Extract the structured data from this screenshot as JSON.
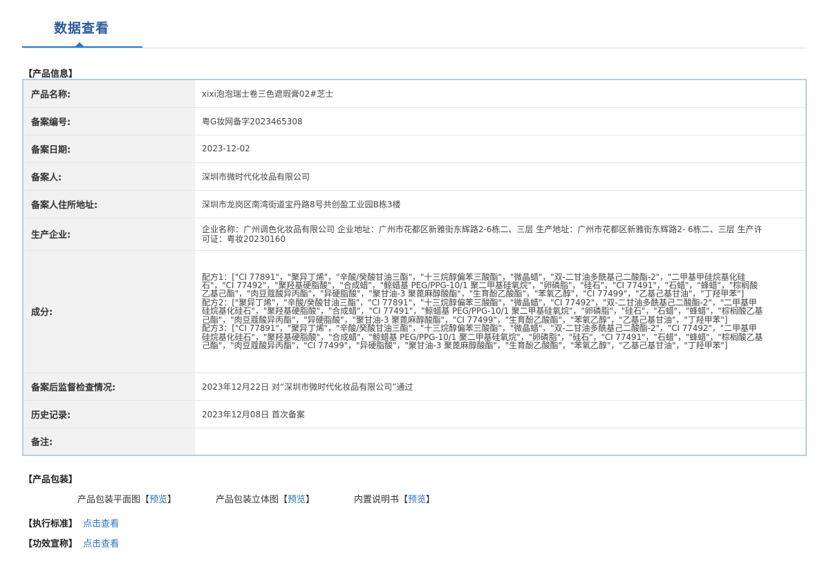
{
  "header": {
    "tab_title": "数据查看"
  },
  "product_info": {
    "section_title": "【产品信息】",
    "rows": [
      {
        "label": "产品名称:",
        "value": "xixi泡泡瑞士卷三色遮瑕膏02#芝士"
      },
      {
        "label": "备案编号:",
        "value": "粤G妆网备字2023465308"
      },
      {
        "label": "备案日期:",
        "value": "2023-12-02"
      },
      {
        "label": "备案人:",
        "value": "深圳市微时代化妆品有限公司"
      },
      {
        "label": "备案人住所地址:",
        "value": "深圳市龙岗区南湾街道宝丹路8号共创盈工业园B栋3楼"
      },
      {
        "label": "生产企业:",
        "value": "企业名称：广州调色化妆品有限公司 企业地址：广州市花都区新雅街东辉路2-6栋二、三层 生产地址：广州市花都区新雅街东辉路2- 6栋二、三层 生产许可证：粤妆20230160"
      },
      {
        "label": "成分:",
        "formulas": [
          "配方1：[\"CI 77891\"，\"聚异丁烯\"，\"辛酸/癸酸甘油三酯\"，\"十三烷醇偏苯三酸酯\"，\"微晶蜡\"，\"双-二甘油多酰基己二酸酯-2\"，\"二甲基甲硅烷基化硅石\"，\"CI 77492\"，\"聚羟基硬脂酸\"，\"合成蜡\"，\"鲸蜡基 PEG/PPG-10/1 聚二甲基硅氧烷\"，\"卵磷脂\"，\"硅石\"，\"CI 77491\"，\"石蜡\"，\"蜂蜡\"，\"棕榈酸乙基己酯\"，\"肉豆蔻酸异丙酯\"，\"异硬脂酸\"，\"聚甘油-3 聚蓖麻醇酸酯\"，\"生育酚乙酸酯\"，\"苯氧乙醇\"，\"CI 77499\"，\"乙基己基甘油\"，\"丁羟甲苯\"]",
          "配方2：[\"聚异丁烯\"，\"辛酸/癸酸甘油三酯\"，\"CI 77891\"，\"十三烷醇偏苯三酸酯\"，\"微晶蜡\"，\"CI 77492\"，\"双-二甘油多酰基己二酸酯-2\"，\"二甲基甲硅烷基化硅石\"，\"聚羟基硬脂酸\"，\"合成蜡\"，\"CI 77491\"，\"鲸蜡基 PEG/PPG-10/1 聚二甲基硅氧烷\"，\"卵磷脂\"，\"硅石\"，\"石蜡\"，\"蜂蜡\"，\"棕榈酸乙基己酯\"，\"肉豆蔻酸异丙酯\"，\"异硬脂酸\"，\"聚甘油-3 聚蓖麻醇酸酯\"，\"CI 77499\"，\"生育酚乙酸酯\"，\"苯氧乙醇\"，\"乙基己基甘油\"，\"丁羟甲苯\"]",
          "配方3：[\"CI 77891\"，\"聚异丁烯\"，\"辛酸/癸酸甘油三酯\"，\"十三烷醇偏苯三酸酯\"，\"微晶蜡\"，\"双-二甘油多酰基己二酸酯-2\"，\"CI 77492\"，\"二甲基甲硅烷基化硅石\"，\"聚羟基硬脂酸\"，\"合成蜡\"，\"鲸蜡基 PEG/PPG-10/1 聚二甲基硅氧烷\"，\"卵磷脂\"，\"硅石\"，\"CI 77491\"，\"石蜡\"，\"蜂蜡\"，\"棕榈酸乙基己酯\"，\"肉豆蔻酸异丙酯\"，\"CI 77499\"，\"异硬脂酸\"，\"聚甘油-3 聚蓖麻醇酸酯\"，\"生育酚乙酸酯\"，\"苯氧乙醇\"，\"乙基己基甘油\"，\"丁羟甲苯\"]"
        ]
      },
      {
        "label": "备案后监督检查情况:",
        "value": "2023年12月22日 对“深圳市微时代化妆品有限公司”通过"
      },
      {
        "label": "历史记录:",
        "value": "2023年12月08日 首次备案"
      },
      {
        "label": "备注:",
        "value": ""
      }
    ]
  },
  "packaging": {
    "section_title": "【产品包装】",
    "items": [
      {
        "label": "产品包装平面图",
        "link": "预览"
      },
      {
        "label": "产品包装立体图",
        "link": "预览"
      },
      {
        "label": "内置说明书",
        "link": "预览"
      }
    ],
    "bracket_open": "【",
    "bracket_close": "】"
  },
  "standards": {
    "label": "【执行标准】",
    "link": "点击查看"
  },
  "efficacy": {
    "label": "【功效宣称】",
    "link": "点击查看"
  }
}
